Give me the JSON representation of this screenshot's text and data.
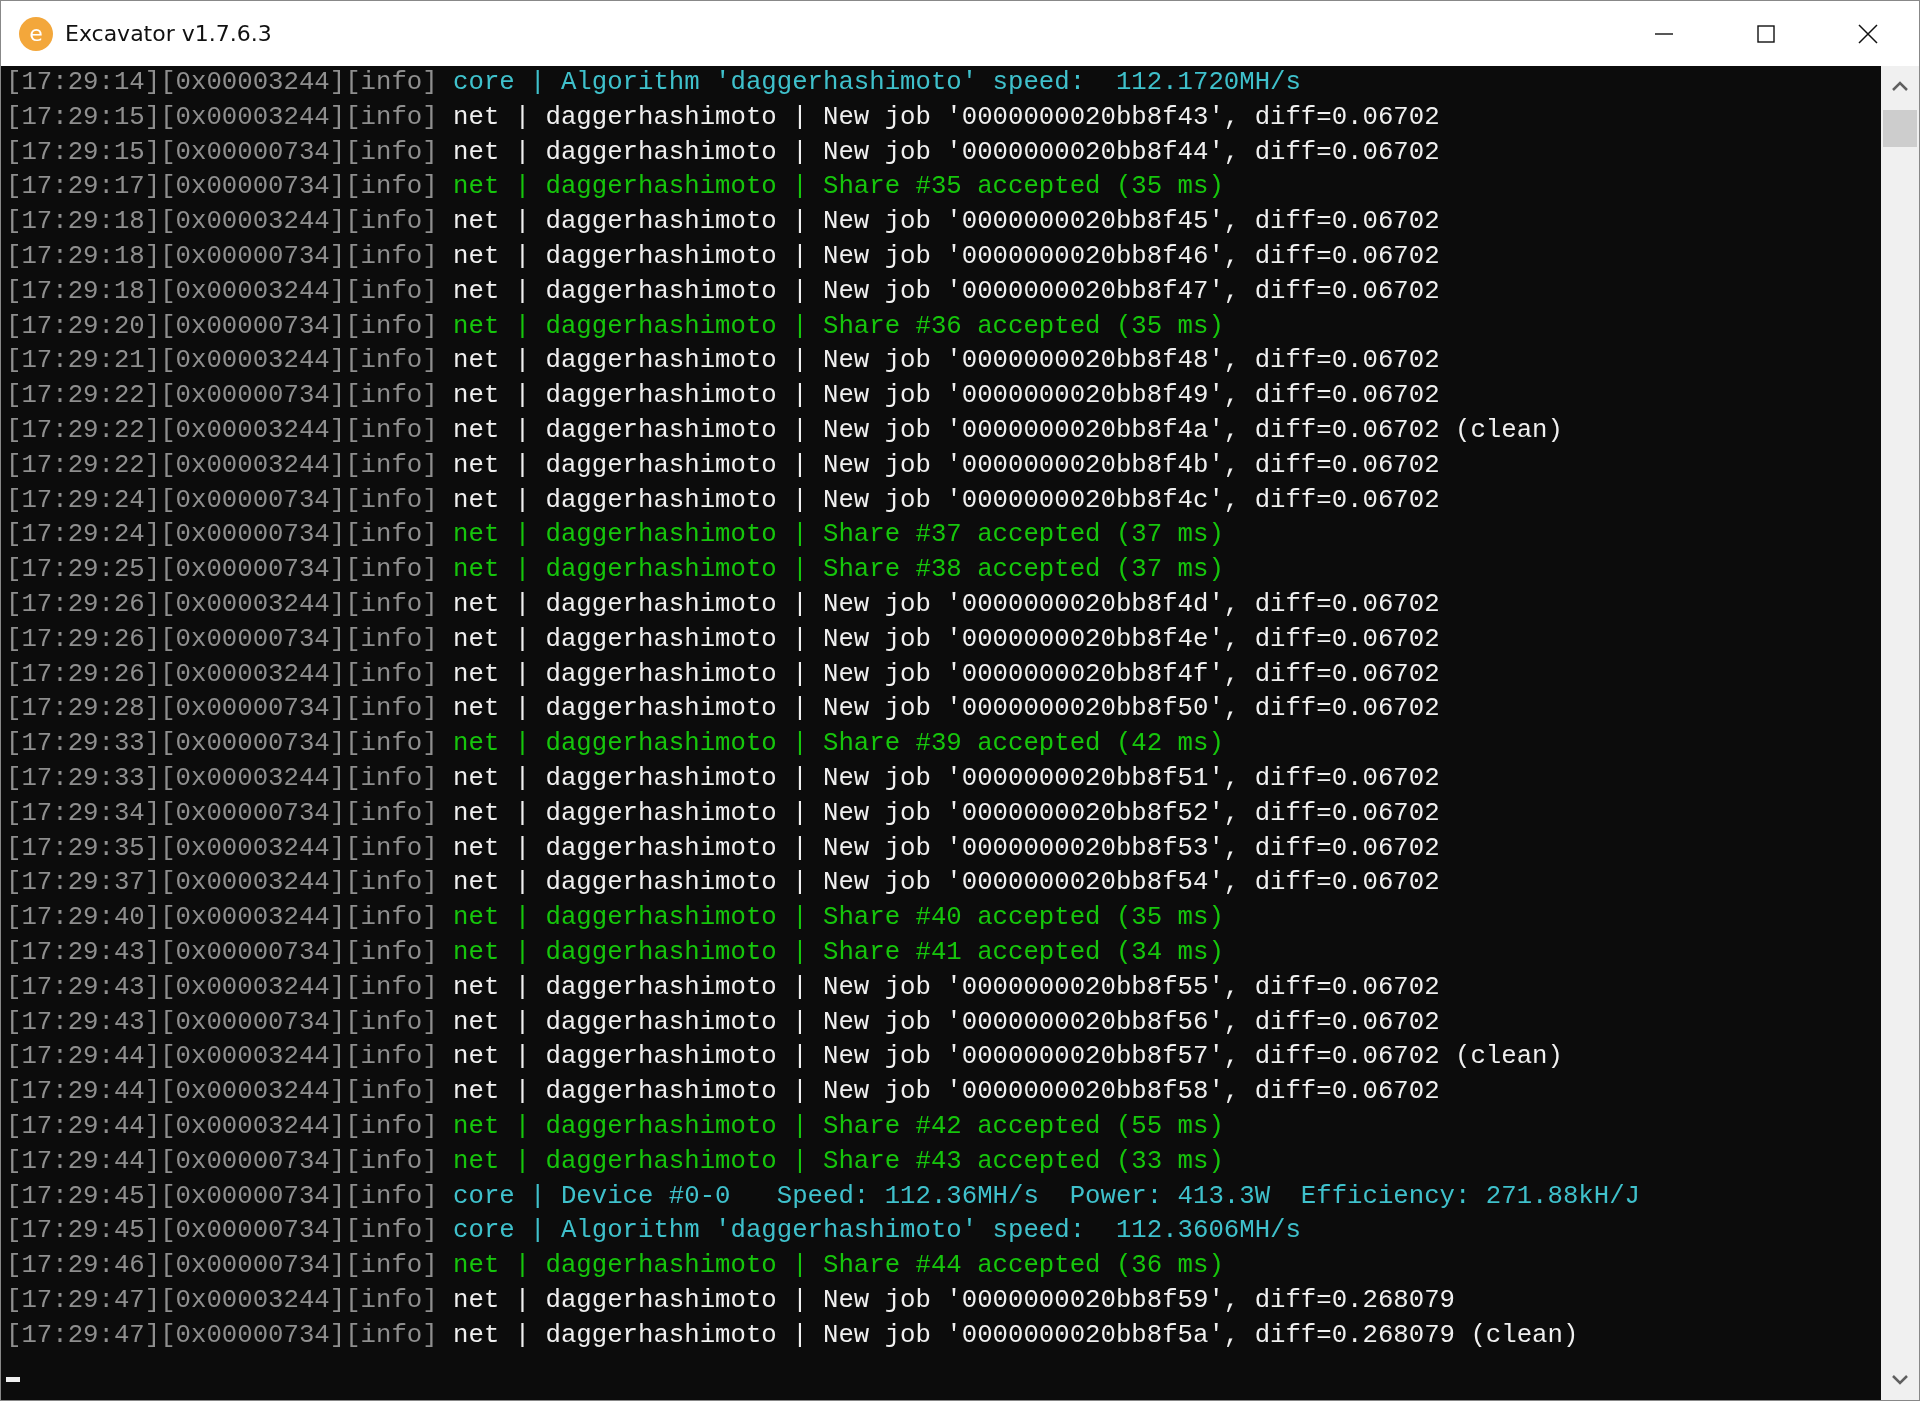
{
  "window": {
    "title": "Excavator v1.7.6.3",
    "logo_letter": "e"
  },
  "console": {
    "lines": [
      {
        "prefix": "[17:29:14][0x00003244][info]",
        "kind": "core",
        "text": "core | Algorithm 'daggerhashimoto' speed:  112.1720MH/s"
      },
      {
        "prefix": "[17:29:15][0x00003244][info]",
        "kind": "net",
        "text": "net | daggerhashimoto | New job '0000000020bb8f43', diff=0.06702"
      },
      {
        "prefix": "[17:29:15][0x00000734][info]",
        "kind": "net",
        "text": "net | daggerhashimoto | New job '0000000020bb8f44', diff=0.06702"
      },
      {
        "prefix": "[17:29:17][0x00000734][info]",
        "kind": "share",
        "text": "net | daggerhashimoto | Share #35 accepted (35 ms)"
      },
      {
        "prefix": "[17:29:18][0x00003244][info]",
        "kind": "net",
        "text": "net | daggerhashimoto | New job '0000000020bb8f45', diff=0.06702"
      },
      {
        "prefix": "[17:29:18][0x00000734][info]",
        "kind": "net",
        "text": "net | daggerhashimoto | New job '0000000020bb8f46', diff=0.06702"
      },
      {
        "prefix": "[17:29:18][0x00003244][info]",
        "kind": "net",
        "text": "net | daggerhashimoto | New job '0000000020bb8f47', diff=0.06702"
      },
      {
        "prefix": "[17:29:20][0x00000734][info]",
        "kind": "share",
        "text": "net | daggerhashimoto | Share #36 accepted (35 ms)"
      },
      {
        "prefix": "[17:29:21][0x00003244][info]",
        "kind": "net",
        "text": "net | daggerhashimoto | New job '0000000020bb8f48', diff=0.06702"
      },
      {
        "prefix": "[17:29:22][0x00000734][info]",
        "kind": "net",
        "text": "net | daggerhashimoto | New job '0000000020bb8f49', diff=0.06702"
      },
      {
        "prefix": "[17:29:22][0x00003244][info]",
        "kind": "net",
        "text": "net | daggerhashimoto | New job '0000000020bb8f4a', diff=0.06702 (clean)"
      },
      {
        "prefix": "[17:29:22][0x00003244][info]",
        "kind": "net",
        "text": "net | daggerhashimoto | New job '0000000020bb8f4b', diff=0.06702"
      },
      {
        "prefix": "[17:29:24][0x00000734][info]",
        "kind": "net",
        "text": "net | daggerhashimoto | New job '0000000020bb8f4c', diff=0.06702"
      },
      {
        "prefix": "[17:29:24][0x00000734][info]",
        "kind": "share",
        "text": "net | daggerhashimoto | Share #37 accepted (37 ms)"
      },
      {
        "prefix": "[17:29:25][0x00000734][info]",
        "kind": "share",
        "text": "net | daggerhashimoto | Share #38 accepted (37 ms)"
      },
      {
        "prefix": "[17:29:26][0x00003244][info]",
        "kind": "net",
        "text": "net | daggerhashimoto | New job '0000000020bb8f4d', diff=0.06702"
      },
      {
        "prefix": "[17:29:26][0x00000734][info]",
        "kind": "net",
        "text": "net | daggerhashimoto | New job '0000000020bb8f4e', diff=0.06702"
      },
      {
        "prefix": "[17:29:26][0x00003244][info]",
        "kind": "net",
        "text": "net | daggerhashimoto | New job '0000000020bb8f4f', diff=0.06702"
      },
      {
        "prefix": "[17:29:28][0x00000734][info]",
        "kind": "net",
        "text": "net | daggerhashimoto | New job '0000000020bb8f50', diff=0.06702"
      },
      {
        "prefix": "[17:29:33][0x00000734][info]",
        "kind": "share",
        "text": "net | daggerhashimoto | Share #39 accepted (42 ms)"
      },
      {
        "prefix": "[17:29:33][0x00003244][info]",
        "kind": "net",
        "text": "net | daggerhashimoto | New job '0000000020bb8f51', diff=0.06702"
      },
      {
        "prefix": "[17:29:34][0x00000734][info]",
        "kind": "net",
        "text": "net | daggerhashimoto | New job '0000000020bb8f52', diff=0.06702"
      },
      {
        "prefix": "[17:29:35][0x00003244][info]",
        "kind": "net",
        "text": "net | daggerhashimoto | New job '0000000020bb8f53', diff=0.06702"
      },
      {
        "prefix": "[17:29:37][0x00003244][info]",
        "kind": "net",
        "text": "net | daggerhashimoto | New job '0000000020bb8f54', diff=0.06702"
      },
      {
        "prefix": "[17:29:40][0x00003244][info]",
        "kind": "share",
        "text": "net | daggerhashimoto | Share #40 accepted (35 ms)"
      },
      {
        "prefix": "[17:29:43][0x00000734][info]",
        "kind": "share",
        "text": "net | daggerhashimoto | Share #41 accepted (34 ms)"
      },
      {
        "prefix": "[17:29:43][0x00003244][info]",
        "kind": "net",
        "text": "net | daggerhashimoto | New job '0000000020bb8f55', diff=0.06702"
      },
      {
        "prefix": "[17:29:43][0x00000734][info]",
        "kind": "net",
        "text": "net | daggerhashimoto | New job '0000000020bb8f56', diff=0.06702"
      },
      {
        "prefix": "[17:29:44][0x00003244][info]",
        "kind": "net",
        "text": "net | daggerhashimoto | New job '0000000020bb8f57', diff=0.06702 (clean)"
      },
      {
        "prefix": "[17:29:44][0x00003244][info]",
        "kind": "net",
        "text": "net | daggerhashimoto | New job '0000000020bb8f58', diff=0.06702"
      },
      {
        "prefix": "[17:29:44][0x00003244][info]",
        "kind": "share",
        "text": "net | daggerhashimoto | Share #42 accepted (55 ms)"
      },
      {
        "prefix": "[17:29:44][0x00000734][info]",
        "kind": "share",
        "text": "net | daggerhashimoto | Share #43 accepted (33 ms)"
      },
      {
        "prefix": "[17:29:45][0x00000734][info]",
        "kind": "core",
        "text": "core | Device #0-0   Speed: 112.36MH/s  Power: 413.3W  Efficiency: 271.88kH/J"
      },
      {
        "prefix": "[17:29:45][0x00000734][info]",
        "kind": "core",
        "text": "core | Algorithm 'daggerhashimoto' speed:  112.3606MH/s"
      },
      {
        "prefix": "[17:29:46][0x00000734][info]",
        "kind": "share",
        "text": "net | daggerhashimoto | Share #44 accepted (36 ms)"
      },
      {
        "prefix": "[17:29:47][0x00003244][info]",
        "kind": "net",
        "text": "net | daggerhashimoto | New job '0000000020bb8f59', diff=0.268079"
      },
      {
        "prefix": "[17:29:47][0x00000734][info]",
        "kind": "net",
        "text": "net | daggerhashimoto | New job '0000000020bb8f5a', diff=0.268079 (clean)"
      }
    ]
  }
}
